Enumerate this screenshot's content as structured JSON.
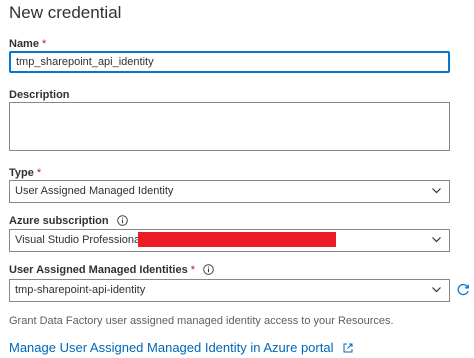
{
  "panel": {
    "title": "New credential"
  },
  "name": {
    "label": "Name",
    "required_mark": "*",
    "value": "tmp_sharepoint_api_identity"
  },
  "description": {
    "label": "Description",
    "value": ""
  },
  "type": {
    "label": "Type",
    "required_mark": "*",
    "selected": "User Assigned Managed Identity"
  },
  "subscription": {
    "label": "Azure subscription",
    "selected": "Visual Studio Professional"
  },
  "identities": {
    "label": "User Assigned Managed Identities",
    "required_mark": "*",
    "selected": "tmp-sharepoint-api-identity"
  },
  "hint_text": "Grant Data Factory user assigned managed identity access to your Resources.",
  "manage_link": "Manage User Assigned Managed Identity in Azure portal",
  "colors": {
    "accent": "#0078d4",
    "required": "#a4262c",
    "link": "#0067b8",
    "redaction": "#ec1c24"
  }
}
